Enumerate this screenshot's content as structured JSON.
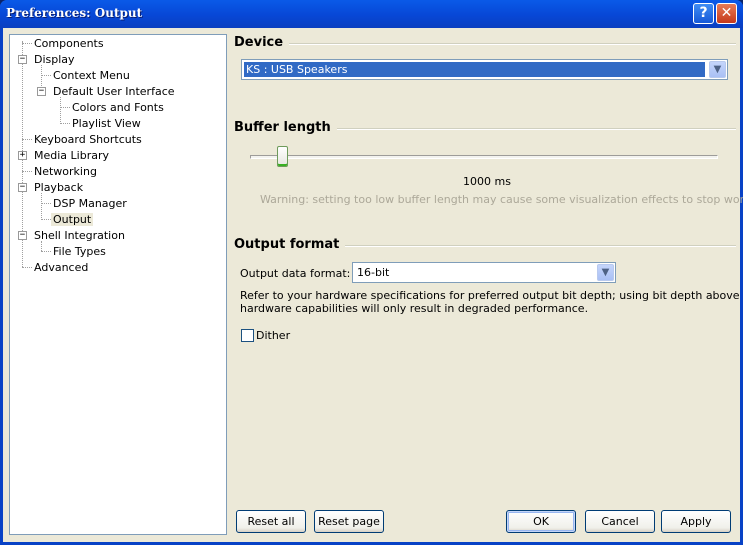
{
  "window": {
    "title": "Preferences: Output",
    "help_glyph": "?",
    "close_glyph": "✕"
  },
  "tree": {
    "items": [
      {
        "label": "Components",
        "expander": ""
      },
      {
        "label": "Display",
        "expander": "−"
      },
      {
        "label": "Context Menu",
        "expander": ""
      },
      {
        "label": "Default User Interface",
        "expander": "−"
      },
      {
        "label": "Colors and Fonts",
        "expander": ""
      },
      {
        "label": "Playlist View",
        "expander": ""
      },
      {
        "label": "Keyboard Shortcuts",
        "expander": ""
      },
      {
        "label": "Media Library",
        "expander": "+"
      },
      {
        "label": "Networking",
        "expander": ""
      },
      {
        "label": "Playback",
        "expander": "−"
      },
      {
        "label": "DSP Manager",
        "expander": ""
      },
      {
        "label": "Output",
        "expander": "",
        "selected": true
      },
      {
        "label": "Shell Integration",
        "expander": "−"
      },
      {
        "label": "File Types",
        "expander": ""
      },
      {
        "label": "Advanced",
        "expander": ""
      }
    ]
  },
  "device": {
    "heading": "Device",
    "selected": "KS : USB Speakers"
  },
  "buffer": {
    "heading": "Buffer length",
    "slider_fraction": 0.06,
    "value_text": "1000 ms",
    "warning": "Warning: setting too low buffer length may cause some visualization effects to stop working."
  },
  "output_format": {
    "heading": "Output format",
    "label": "Output data format:",
    "selected": "16-bit",
    "note_line1": "Refer to your hardware specifications for preferred output bit depth; using bit depth above your",
    "note_line2": "hardware capabilities will only result in degraded performance.",
    "dither_label": "Dither",
    "dither_checked": false
  },
  "buttons": {
    "reset_all": "Reset all",
    "reset_page": "Reset page",
    "ok": "OK",
    "cancel": "Cancel",
    "apply": "Apply"
  },
  "icons": {
    "dropdown": "chevron-down-icon",
    "dropdown_glyph": "▼"
  }
}
